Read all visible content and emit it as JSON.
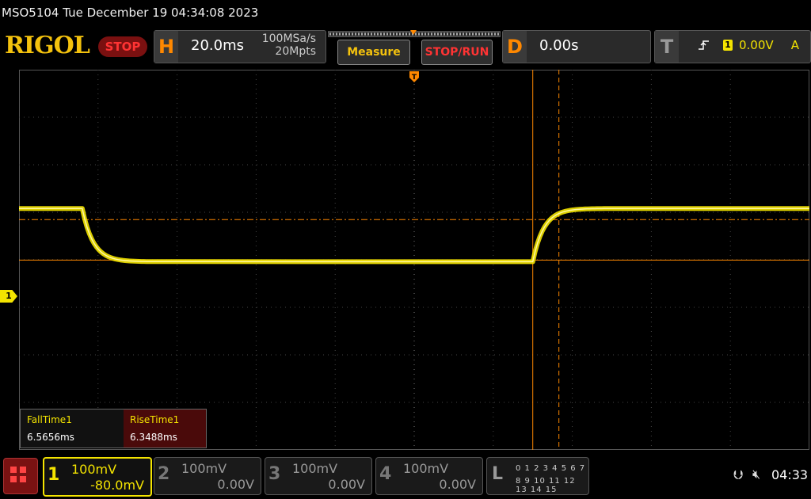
{
  "title": "MSO5104  Tue December 19 04:34:08 2023",
  "logo": "RIGOL",
  "run_state": "STOP",
  "horizontal": {
    "tag": "H",
    "timebase": "20.0ms",
    "sample_rate": "100MSa/s",
    "mem_depth": "20Mpts"
  },
  "buttons": {
    "measure": "Measure",
    "stop_run": "STOP/RUN"
  },
  "delay": {
    "tag": "D",
    "value": "0.00s"
  },
  "trigger": {
    "tag": "T",
    "edge_icon": "rising-edge-icon",
    "channel": "1",
    "level": "0.00V",
    "mode": "A"
  },
  "ch1_marker": "1",
  "measurements": [
    {
      "name": "FallTime1",
      "value": "6.5656ms"
    },
    {
      "name": "RiseTime1",
      "value": "6.3488ms"
    }
  ],
  "channels": [
    {
      "num": "1",
      "scale": "100mV",
      "offset": "-80.0mV",
      "active": true
    },
    {
      "num": "2",
      "scale": "100mV",
      "offset": "0.00V",
      "active": false
    },
    {
      "num": "3",
      "scale": "100mV",
      "offset": "0.00V",
      "active": false
    },
    {
      "num": "4",
      "scale": "100mV",
      "offset": "0.00V",
      "active": false
    }
  ],
  "la": {
    "tag": "L",
    "row1": "0 1 2 3  4 5 6 7",
    "row2": "8 9 10 11 12 13 14 15"
  },
  "status": {
    "usb_icon": "usb-icon",
    "speaker_icon": "speaker-muted-icon",
    "time": "04:33"
  },
  "colors": {
    "trace": "#f4e400",
    "accent": "#ff8800",
    "stop": "#ff3333"
  },
  "waveform": {
    "high_level_div": -1.08,
    "low_level_div": 0.04,
    "fall_start_time_div": -4.2,
    "rise_start_time_div": 1.5
  }
}
